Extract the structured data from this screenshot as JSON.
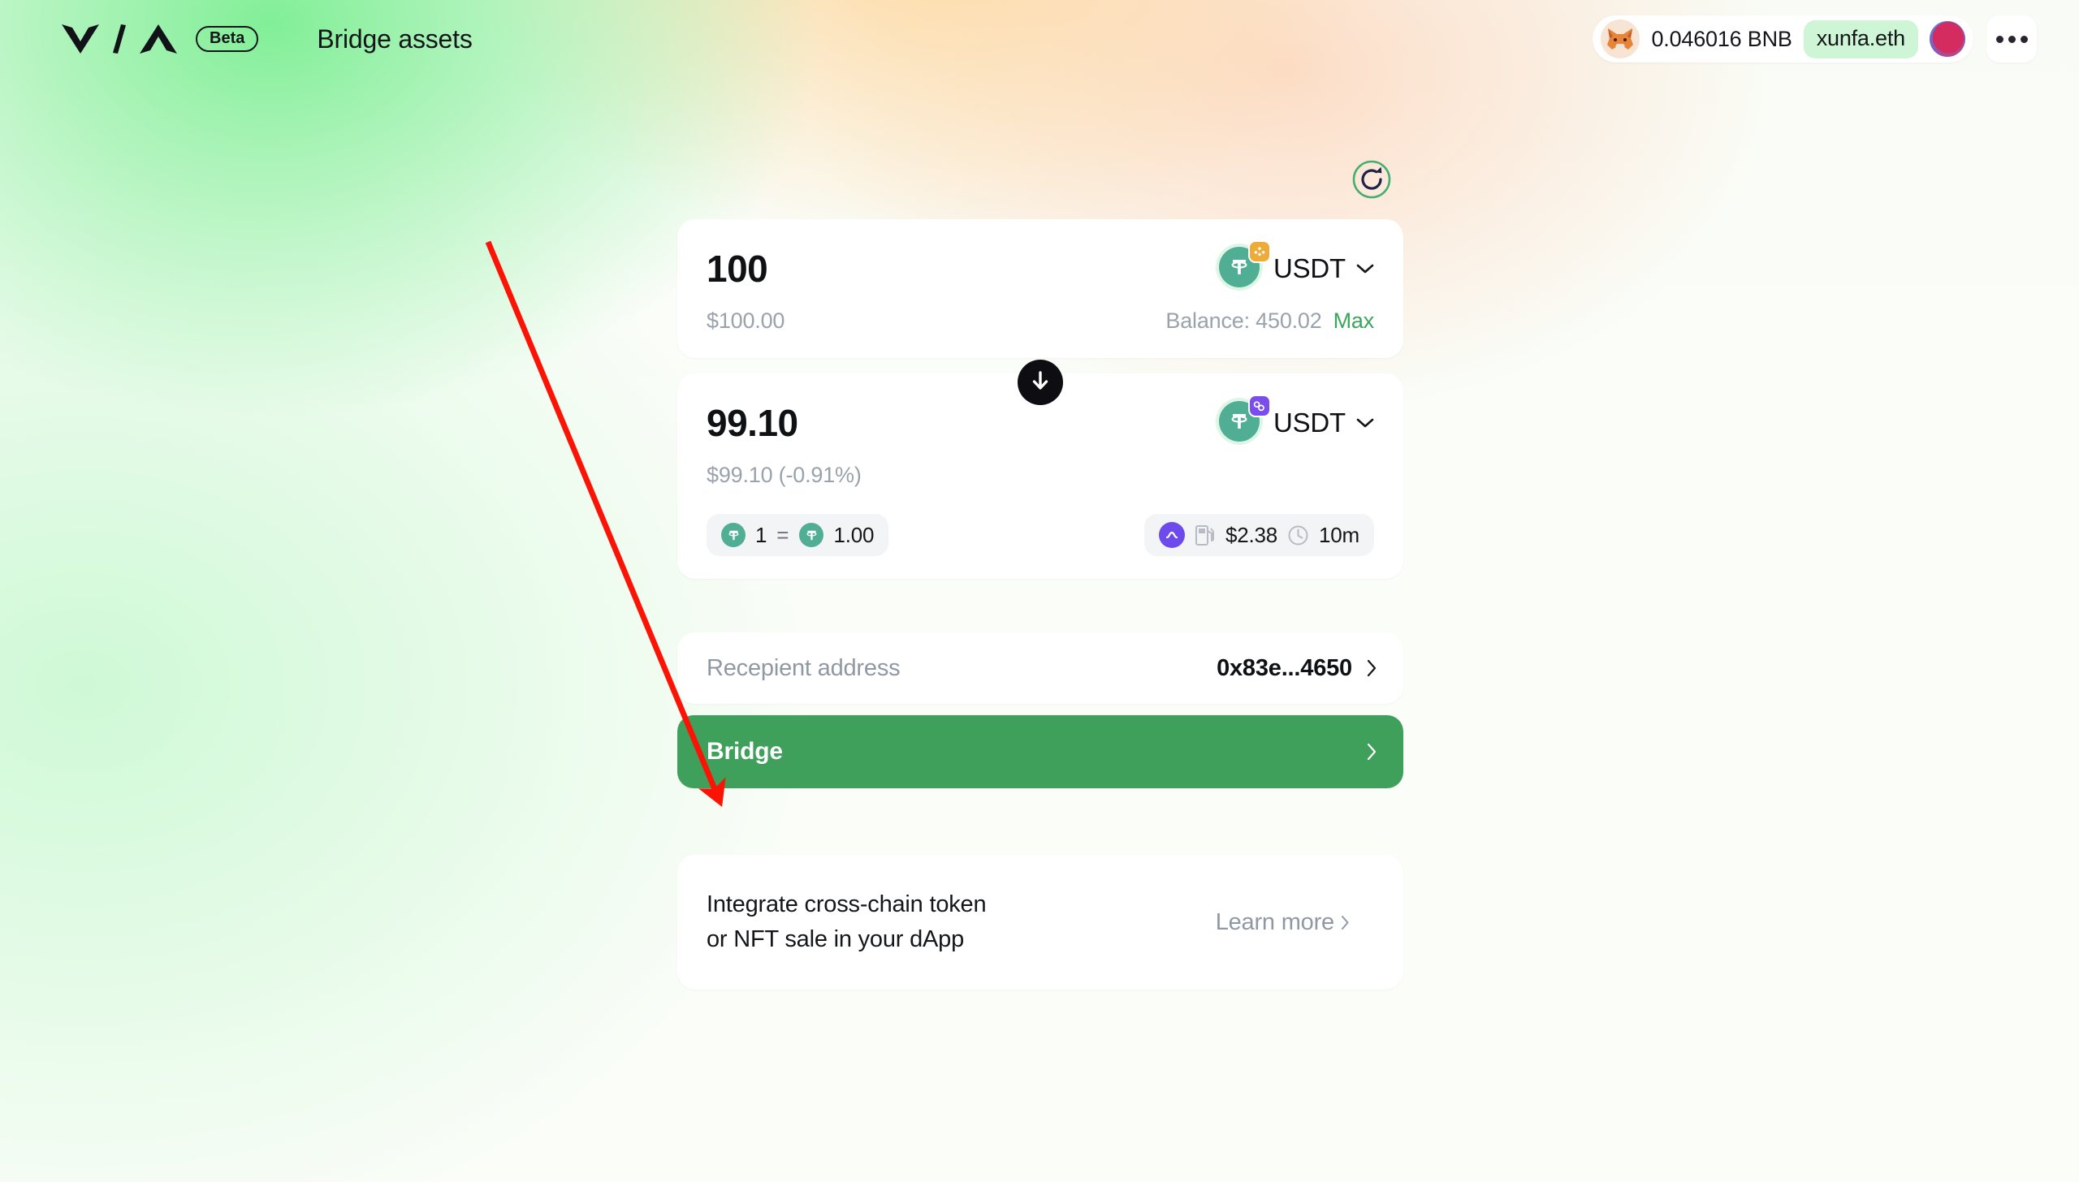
{
  "header": {
    "brand": "VIA",
    "beta_label": "Beta",
    "page_title": "Bridge assets",
    "wallet": {
      "icon": "metamask-fox-icon",
      "balance": "0.046016 BNB",
      "ens_name": "xunfa.eth",
      "avatar": "account-avatar"
    },
    "more_menu": "..."
  },
  "toolbar": {
    "refresh_icon": "refresh-icon"
  },
  "from": {
    "amount": "100",
    "fiat": "$100.00",
    "balance_label": "Balance: 450.02",
    "max_label": "Max",
    "token_symbol": "USDT",
    "token_icon": "tether-icon",
    "chain_badge": "bnb-chain-icon",
    "chevron": "chevron-down-icon"
  },
  "swap": {
    "icon": "arrow-down-icon"
  },
  "to": {
    "amount": "99.10",
    "fiat": "$99.10 (-0.91%)",
    "token_symbol": "USDT",
    "token_icon": "tether-icon",
    "chain_badge": "polygon-icon",
    "chevron": "chevron-down-icon"
  },
  "rate_pill": {
    "left_icon": "tether-icon",
    "left_amount": "1",
    "equals": "=",
    "right_icon": "tether-icon",
    "right_amount": "1.00"
  },
  "route_pill": {
    "provider_icon": "bridge-provider-icon",
    "gas_icon": "gas-pump-icon",
    "gas_fee": "$2.38",
    "time_icon": "clock-icon",
    "time": "10m"
  },
  "recipient": {
    "label": "Recepient address",
    "value": "0x83e...4650",
    "chevron": "chevron-right-icon"
  },
  "bridge_button": {
    "label": "Bridge",
    "chevron": "chevron-right-icon"
  },
  "promo": {
    "line1": "Integrate cross-chain token",
    "line2": "or NFT sale in your dApp",
    "link_label": "Learn more",
    "link_chevron": "chevron-right-icon"
  },
  "annotation": {
    "type": "red-arrow",
    "color": "#fb1405",
    "points_to": "bridge-button"
  },
  "colors": {
    "accent_green": "#3fa05c",
    "max_green": "#39a65c",
    "ens_chip": "#cdf5d6",
    "tether": "#50ae94",
    "bnb": "#edac3a",
    "polygon": "#7a4ded",
    "provider_purple": "#6d4aeb"
  }
}
